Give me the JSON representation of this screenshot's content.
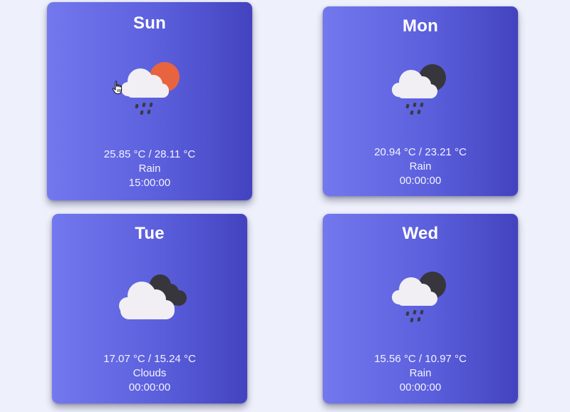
{
  "forecast": [
    {
      "day": "Sun",
      "temps": "25.85 °C / 28.11 °C",
      "condition": "Rain",
      "time": "15:00:00",
      "icon": "cloud-sun-rain-icon",
      "celestial_color": "#e8643f"
    },
    {
      "day": "Mon",
      "temps": "20.94 °C / 23.21 °C",
      "condition": "Rain",
      "time": "00:00:00",
      "icon": "cloud-moon-rain-icon",
      "celestial_color": "#37363c"
    },
    {
      "day": "Tue",
      "temps": "17.07 °C / 15.24 °C",
      "condition": "Clouds",
      "time": "00:00:00",
      "icon": "clouds-icon",
      "celestial_color": "#37363c"
    },
    {
      "day": "Wed",
      "temps": "15.56 °C / 10.97 °C",
      "condition": "Rain",
      "time": "00:00:00",
      "icon": "cloud-moon-rain-icon",
      "celestial_color": "#37363c"
    }
  ],
  "colors": {
    "background": "#eef0fb",
    "card_gradient_start": "#7378ee",
    "card_gradient_end": "#4343bf",
    "cloud": "#f1eff3",
    "rain": "#3a3940"
  },
  "cursor": "hand-pointer-icon"
}
